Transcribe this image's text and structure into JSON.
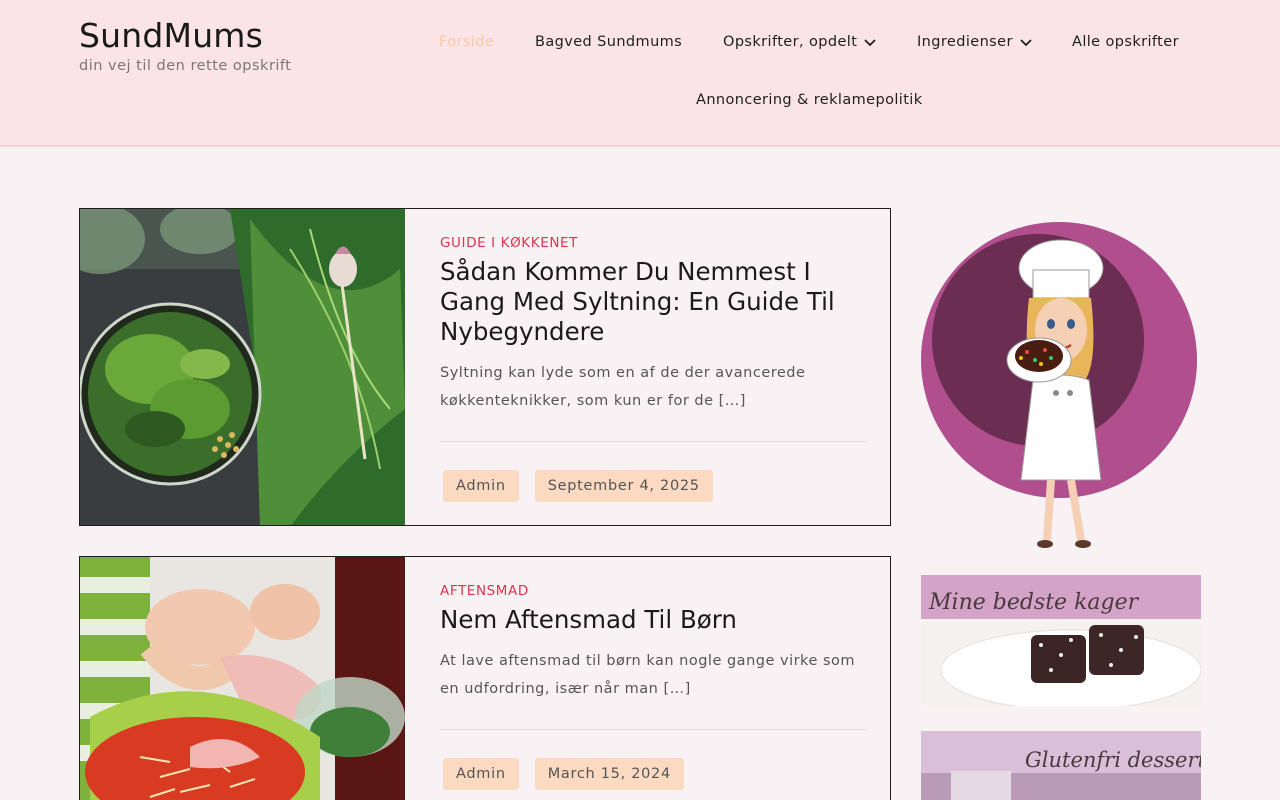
{
  "site": {
    "title": "SundMums",
    "tagline": "din vej til den rette opskrift"
  },
  "nav": {
    "items": [
      {
        "label": "Forside",
        "active": true
      },
      {
        "label": "Bagved Sundmums"
      },
      {
        "label": "Opskrifter, opdelt",
        "dropdown": true
      },
      {
        "label": "Ingredienser",
        "dropdown": true
      },
      {
        "label": "Alle opskrifter"
      },
      {
        "label": "Annoncering & reklamepolitik"
      }
    ]
  },
  "posts": [
    {
      "category": "GUIDE I KØKKENET",
      "title": "Sådan Kommer Du Nemmest I Gang Med Syltning: En Guide Til Nybegyndere",
      "excerpt": "Syltning kan lyde som en af de der avancerede køkkenteknikker, som kun er for de […]",
      "author": "Admin",
      "date": "September 4, 2025"
    },
    {
      "category": "AFTENSMAD",
      "title": "Nem Aftensmad Til Børn",
      "excerpt": "At lave aftensmad til børn kan nogle gange virke som en udfordring, især når man […]",
      "author": "Admin",
      "date": "March 15, 2024"
    }
  ],
  "sidebar": {
    "banners": [
      {
        "text": "Mine bedste kager"
      },
      {
        "text": "Glutenfri desserter"
      }
    ]
  },
  "colors": {
    "header_bg": "#fbe4e7",
    "page_bg": "#f8f2f4",
    "category": "#e0344e",
    "pill_bg": "#fcd9c1",
    "nav_active": "#f7c9a6"
  }
}
